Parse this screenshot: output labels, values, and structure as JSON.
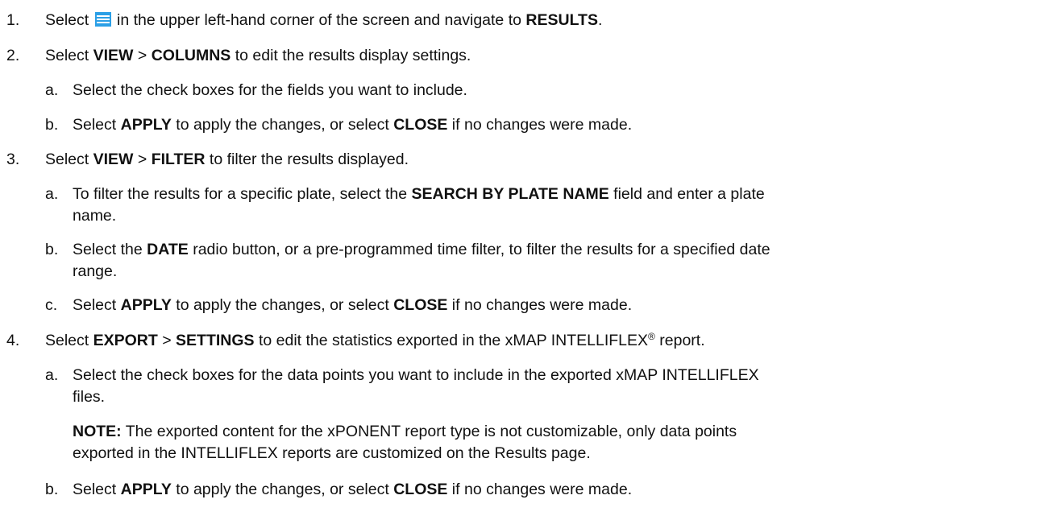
{
  "steps": [
    {
      "number": "1.",
      "parts": [
        "Select ",
        " in the upper left-hand corner of the screen and navigate to ",
        "RESULTS",
        "."
      ],
      "icon": "menu-icon",
      "icon_color": "#2b9fe6"
    },
    {
      "number": "2.",
      "parts": [
        "Select ",
        "VIEW",
        " > ",
        "COLUMNS",
        " to edit the results display settings."
      ],
      "substeps": [
        {
          "letter": "a.",
          "parts": [
            "Select the check boxes for the fields you want to include."
          ]
        },
        {
          "letter": "b.",
          "parts": [
            "Select ",
            "APPLY",
            " to apply the changes, or select ",
            "CLOSE",
            " if no changes were made."
          ]
        }
      ]
    },
    {
      "number": "3.",
      "parts": [
        "Select ",
        "VIEW",
        " > ",
        "FILTER",
        " to filter the results displayed."
      ],
      "substeps": [
        {
          "letter": "a.",
          "parts": [
            "To filter the results for a specific plate, select the ",
            "SEARCH BY PLATE NAME",
            " field and enter a plate"
          ],
          "continuation": "name."
        },
        {
          "letter": "b.",
          "parts": [
            "Select the ",
            "DATE",
            " radio button, or a pre-programmed time filter, to filter the results for a specified date"
          ],
          "continuation": "range."
        },
        {
          "letter": "c.",
          "parts": [
            "Select ",
            "APPLY",
            " to apply the changes, or select ",
            "CLOSE",
            " if no changes were made."
          ]
        }
      ]
    },
    {
      "number": "4.",
      "parts": [
        "Select ",
        "EXPORT",
        " > ",
        "SETTINGS",
        " to edit the statistics exported in the xMAP INTELLIFLEX",
        "®",
        " report."
      ],
      "substeps": [
        {
          "letter": "a.",
          "parts": [
            "Select the check boxes for the data points you want to include in the exported xMAP INTELLIFLEX"
          ],
          "continuation": "files."
        },
        {
          "letter": "b.",
          "parts": [
            "Select ",
            "APPLY",
            " to apply the changes, or select ",
            "CLOSE",
            " if no changes were made."
          ]
        }
      ],
      "note": {
        "label": "NOTE:",
        "line1": " The exported content for the xPONENT report type is not customizable, only data points",
        "line2": "exported in the INTELLIFLEX reports are customized on the Results page."
      }
    }
  ]
}
